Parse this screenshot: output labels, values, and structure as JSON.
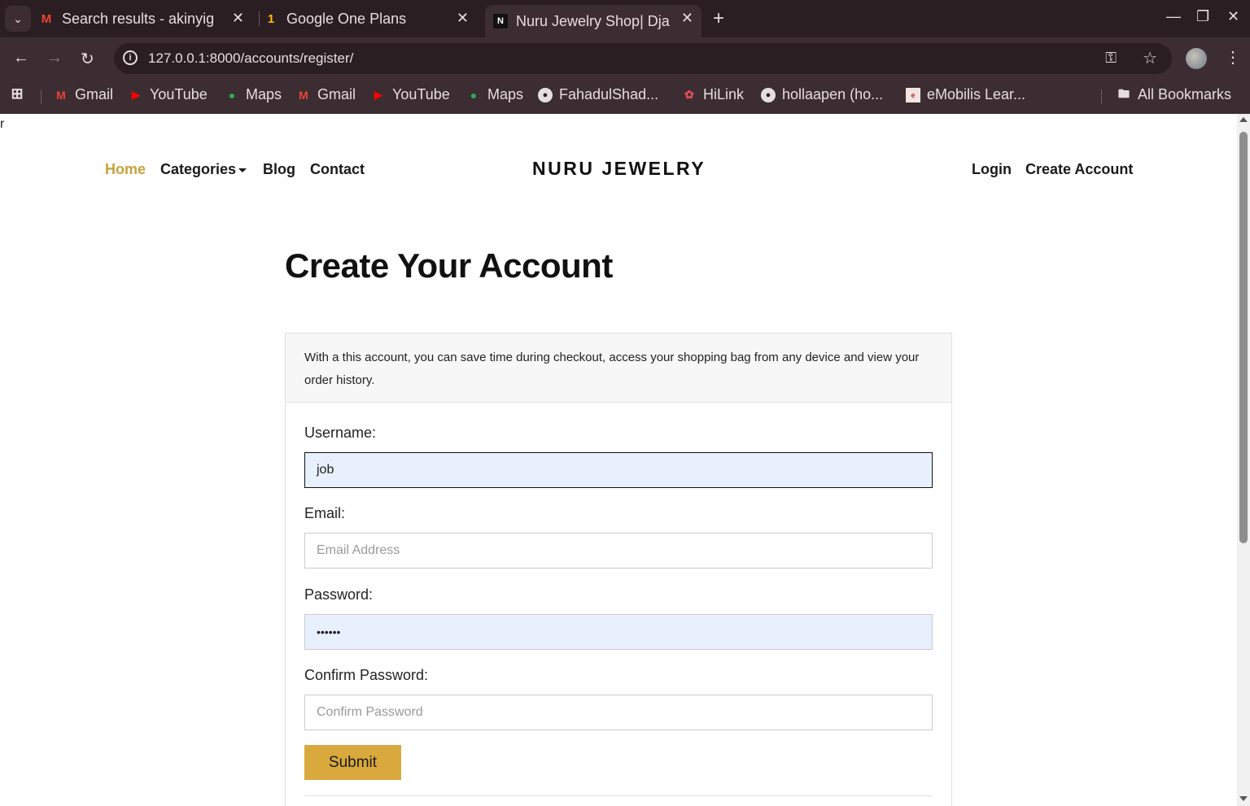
{
  "browser": {
    "tabs": [
      {
        "title": "Search results - akinyig",
        "favicon": "gmail-icon"
      },
      {
        "title": "Google One Plans",
        "favicon": "google-one-icon"
      },
      {
        "title": "Nuru Jewelry Shop| Dja",
        "favicon": "site-icon"
      }
    ],
    "url": "127.0.0.1:8000/accounts/register/",
    "bookmarks": [
      {
        "label": "Gmail",
        "icon": "gmail-icon"
      },
      {
        "label": "YouTube",
        "icon": "youtube-icon"
      },
      {
        "label": "Maps",
        "icon": "maps-icon"
      },
      {
        "label": "Gmail",
        "icon": "gmail-icon"
      },
      {
        "label": "YouTube",
        "icon": "youtube-icon"
      },
      {
        "label": "Maps",
        "icon": "maps-icon"
      },
      {
        "label": "FahadulShad...",
        "icon": "github-icon"
      },
      {
        "label": "HiLink",
        "icon": "hilink-icon"
      },
      {
        "label": "hollaapen (ho...",
        "icon": "github-icon"
      },
      {
        "label": "eMobilis Lear...",
        "icon": "emobilis-icon"
      }
    ],
    "all_bookmarks": "All Bookmarks"
  },
  "page": {
    "stray_text": "r",
    "nav": {
      "home": "Home",
      "categories": "Categories",
      "blog": "Blog",
      "contact": "Contact",
      "login": "Login",
      "create_account": "Create Account"
    },
    "brand": "NURU JEWELRY",
    "heading": "Create Your Account",
    "intro": "With a this account, you can save time during checkout, access your shopping bag from any device and view your order history.",
    "form": {
      "username_label": "Username:",
      "username_value": "job",
      "email_label": "Email:",
      "email_placeholder": "Email Address",
      "password_label": "Password:",
      "password_value": "••••••",
      "confirm_label": "Confirm Password:",
      "confirm_placeholder": "Confirm Password",
      "submit": "Submit"
    }
  },
  "colors": {
    "accent": "#d9a93d",
    "home_link": "#c9a13b",
    "chrome_dark": "#2b1e23",
    "chrome": "#3c2d33",
    "autofill": "#e8f0fe"
  }
}
